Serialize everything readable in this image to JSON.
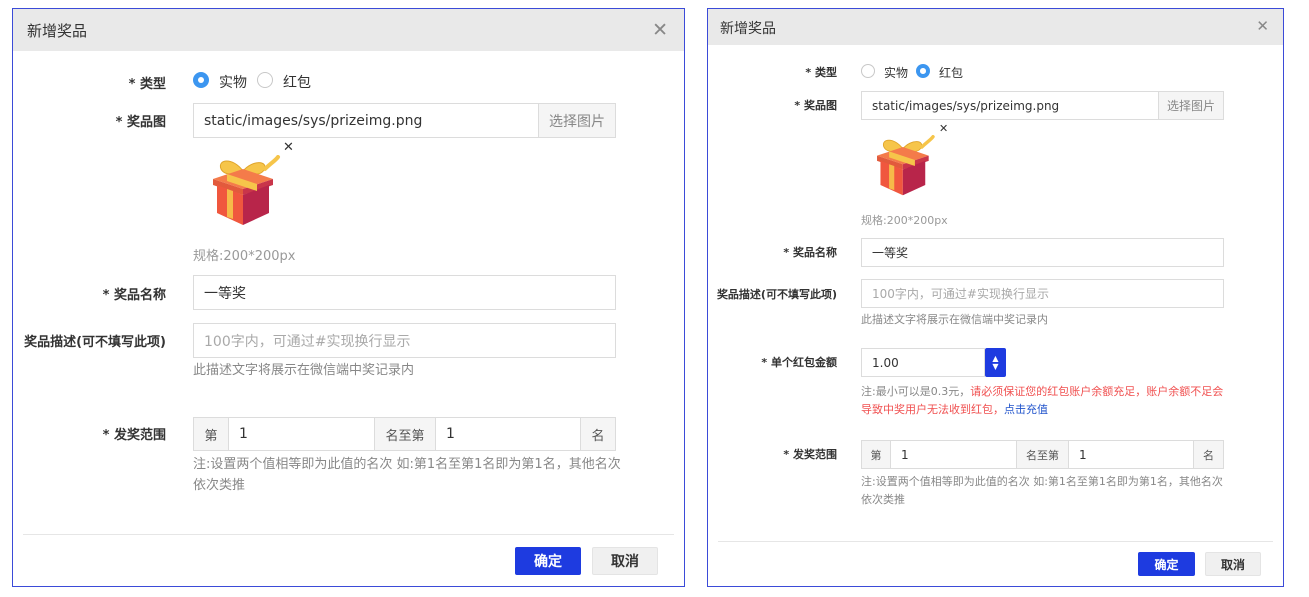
{
  "dialog_left": {
    "title": "新增奖品",
    "type_label": "类型",
    "type_options": [
      "实物",
      "红包"
    ],
    "type_selected": "实物",
    "image_label": "奖品图",
    "image_path": "static/images/sys/prizeimg.png",
    "image_button": "选择图片",
    "image_spec": "规格:200*200px",
    "name_label": "奖品名称",
    "name_value": "一等奖",
    "desc_label": "奖品描述(可不填写此项)",
    "desc_placeholder": "100字内，可通过#实现换行显示",
    "desc_hint": "此描述文字将展示在微信端中奖记录内",
    "range_label": "发奖范围",
    "range_prefix": "第",
    "range_from": "1",
    "range_middle": "名至第",
    "range_to": "1",
    "range_suffix": "名",
    "range_hint": "注:设置两个值相等即为此值的名次 如:第1名至第1名即为第1名，其他名次依次类推",
    "confirm": "确定",
    "cancel": "取消"
  },
  "dialog_right": {
    "title": "新增奖品",
    "type_label": "类型",
    "type_options": [
      "实物",
      "红包"
    ],
    "type_selected": "红包",
    "image_label": "奖品图",
    "image_path": "static/images/sys/prizeimg.png",
    "image_button": "选择图片",
    "image_spec": "规格:200*200px",
    "name_label": "奖品名称",
    "name_value": "一等奖",
    "desc_label": "奖品描述(可不填写此项)",
    "desc_placeholder": "100字内，可通过#实现换行显示",
    "desc_hint": "此描述文字将展示在微信端中奖记录内",
    "amount_label": "单个红包金额",
    "amount_value": "1.00",
    "amount_hint_prefix": "注:最小可以是0.3元，",
    "amount_hint_warn": "请必须保证您的红包账户余额充足，账户余额不足会导致中奖用户无法收到红包，",
    "amount_hint_link": "点击充值",
    "range_label": "发奖范围",
    "range_prefix": "第",
    "range_from": "1",
    "range_middle": "名至第",
    "range_to": "1",
    "range_suffix": "名",
    "range_hint": "注:设置两个值相等即为此值的名次 如:第1名至第1名即为第1名，其他名次依次类推",
    "confirm": "确定",
    "cancel": "取消"
  },
  "icons": [
    "close-icon",
    "gift-icon",
    "remove-image-icon",
    "spinner-up-icon",
    "spinner-down-icon"
  ],
  "colors": {
    "primary": "#1e3be0",
    "radio_checked": "#3c96f0",
    "warning": "#f05050",
    "link": "#2255cc",
    "titlebar": "#e9e9e9"
  }
}
